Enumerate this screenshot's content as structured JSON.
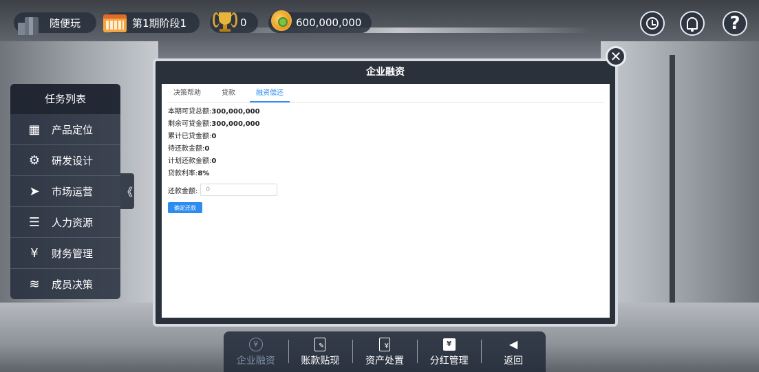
{
  "topbar": {
    "user_name": "随便玩",
    "period": "第1期阶段1",
    "trophy_count": "0",
    "coins": "600,000,000"
  },
  "top_buttons": {
    "help_glyph": "?"
  },
  "sidebar": {
    "title": "任务列表",
    "items": [
      {
        "label": "产品定位",
        "icon": "grid-icon",
        "glyph": "▦"
      },
      {
        "label": "研发设计",
        "icon": "gear-icon",
        "glyph": "⚙"
      },
      {
        "label": "市场运营",
        "icon": "paper-plane-icon",
        "glyph": "➤"
      },
      {
        "label": "人力资源",
        "icon": "person-list-icon",
        "glyph": "☰"
      },
      {
        "label": "财务管理",
        "icon": "yen-icon",
        "glyph": "¥"
      },
      {
        "label": "成员决策",
        "icon": "layers-icon",
        "glyph": "≋"
      }
    ],
    "collapse_glyph": "《"
  },
  "modal": {
    "title": "企业融资",
    "close_glyph": "✕",
    "tabs": [
      {
        "label": "决策帮助",
        "active": false
      },
      {
        "label": "贷款",
        "active": false
      },
      {
        "label": "融资偿还",
        "active": true
      }
    ],
    "rows": [
      {
        "label": "本期可贷总额:",
        "value": "300,000,000"
      },
      {
        "label": "剩余可贷金额:",
        "value": "300,000,000"
      },
      {
        "label": "累计已贷金额:",
        "value": "0"
      },
      {
        "label": "待还款金额:",
        "value": "0"
      },
      {
        "label": "计划还款金额:",
        "value": "0"
      },
      {
        "label": "贷款利率:",
        "value": "8%"
      }
    ],
    "repay": {
      "label": "还款金额:",
      "value": "0"
    },
    "confirm_label": "确定还款"
  },
  "bottombar": {
    "items": [
      {
        "label": "企业融资",
        "icon": "yen-coin-icon",
        "active": true
      },
      {
        "label": "账款贴现",
        "icon": "document-pen-icon",
        "active": false
      },
      {
        "label": "资产处置",
        "icon": "document-yen-icon",
        "active": false
      },
      {
        "label": "分红管理",
        "icon": "dividend-box-icon",
        "active": false
      },
      {
        "label": "返回",
        "icon": "back-arrow-icon",
        "active": false
      }
    ]
  },
  "colors": {
    "accent": "#2d8cf0",
    "panel_dark": "#2b313b"
  }
}
